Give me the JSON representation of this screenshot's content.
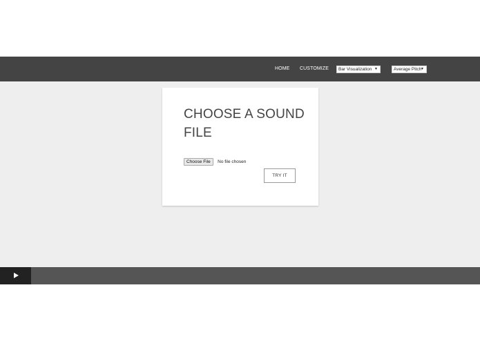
{
  "nav": {
    "home": "HOME",
    "customize": "CUSTOMIZE",
    "visualization_select": "Bar Visualization",
    "pitch_select": "Average Pitch"
  },
  "card": {
    "title": "CHOOSE A SOUND FILE",
    "file_button": "Choose File",
    "file_status": "No file chosen",
    "try_button": "TRY IT"
  },
  "player": {
    "play_icon": "play-icon"
  },
  "colors": {
    "nav_bg": "#444444",
    "page_bg": "#eeeeee",
    "card_bg": "#ffffff",
    "player_bg": "#555555",
    "play_button_bg": "#222222"
  }
}
